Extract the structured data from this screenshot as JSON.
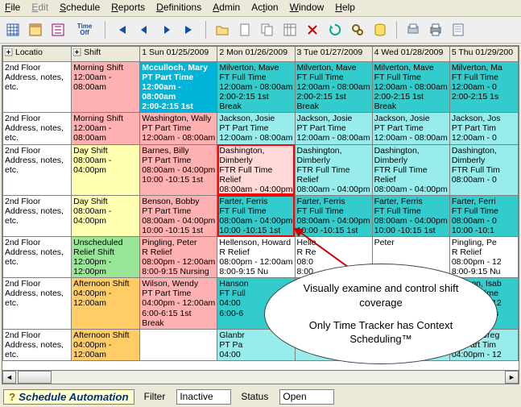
{
  "menu": {
    "file": "File",
    "edit": "Edit",
    "schedule": "Schedule",
    "reports": "Reports",
    "definitions": "Definitions",
    "admin": "Admin",
    "action": "Action",
    "window": "Window",
    "help": "Help"
  },
  "toolbar": {
    "timeoff_label": "Time Off"
  },
  "header": {
    "locatio": "Locatio",
    "shift": "Shift",
    "d1": "1 Sun 01/25/2009",
    "d2": "2 Mon 01/26/2009",
    "d3": "3 Tue 01/27/2009",
    "d4": "4 Wed 01/28/2009",
    "d5": "5 Thu 01/29/200"
  },
  "rows": [
    {
      "loc": {
        "l1": "2nd Floor",
        "l2": "Address, notes,",
        "l3": "etc."
      },
      "shift": {
        "cls": "c-pink",
        "l1": "Morning Shift",
        "l2": "12:00am -",
        "l3": "08:00am"
      },
      "cells": [
        {
          "cls": "highlight",
          "l1": "Mcculloch, Mary",
          "l2": "PT Part Time",
          "l3": "12:00am - 08:00am",
          "l4": "2:00-2:15 1st"
        },
        {
          "cls": "c-cyan",
          "l1": "Milverton, Mave",
          "l2": "FT Full Time",
          "l3": "12:00am - 08:00am",
          "l4": "2:00-2:15 1st Break"
        },
        {
          "cls": "c-cyan",
          "l1": "Milverton, Mave",
          "l2": "FT Full Time",
          "l3": "12:00am - 08:00am",
          "l4": "2:00-2:15 1st Break"
        },
        {
          "cls": "c-cyan",
          "l1": "Milverton, Mave",
          "l2": "FT Full Time",
          "l3": "12:00am - 08:00am",
          "l4": "2:00-2:15 1st Break"
        },
        {
          "cls": "c-cyan",
          "l1": "Milverton, Ma",
          "l2": "FT Full Time",
          "l3": "12:00am - 0",
          "l4": "2:00-2:15 1s"
        }
      ]
    },
    {
      "loc": {
        "l1": "2nd Floor",
        "l2": "Address, notes,",
        "l3": "etc."
      },
      "shift": {
        "cls": "c-pink",
        "l1": "Morning Shift",
        "l2": "12:00am -",
        "l3": "08:00am"
      },
      "cells": [
        {
          "cls": "c-pink",
          "l1": "Washington, Wally",
          "l2": "PT Part Time",
          "l3": "12:00am - 08:00am"
        },
        {
          "cls": "c-ltcyan",
          "l1": "Jackson, Josie",
          "l2": "PT Part Time",
          "l3": "12:00am - 08:00am"
        },
        {
          "cls": "c-ltcyan",
          "l1": "Jackson, Josie",
          "l2": "PT Part Time",
          "l3": "12:00am - 08:00am"
        },
        {
          "cls": "c-ltcyan",
          "l1": "Jackson, Josie",
          "l2": "PT Part Time",
          "l3": "12:00am - 08:00am"
        },
        {
          "cls": "c-ltcyan",
          "l1": "Jackson, Jos",
          "l2": "PT Part Tim",
          "l3": "12:00am - 0"
        }
      ]
    },
    {
      "loc": {
        "l1": "2nd Floor",
        "l2": "Address, notes,",
        "l3": "etc."
      },
      "shift": {
        "cls": "c-yellow",
        "l1": "Day Shift",
        "l2": "08:00am -",
        "l3": "04:00pm"
      },
      "cells": [
        {
          "cls": "c-pink",
          "l1": "Barnes, Billy",
          "l2": "PT Part Time",
          "l3": "08:00am - 04:00pm",
          "l4": "10:00 -10:15 1st"
        },
        {
          "cls": "c-ltpink red-outline",
          "l1": "Dashington, Dimberly",
          "l2": "FTR Full Time Relief",
          "l3": "08:00am - 04:00pm"
        },
        {
          "cls": "c-ltcyan",
          "l1": "Dashington, Dimberly",
          "l2": "FTR Full Time Relief",
          "l3": "08:00am - 04:00pm"
        },
        {
          "cls": "c-ltcyan",
          "l1": "Dashington, Dimberly",
          "l2": "FTR Full Time Relief",
          "l3": "08:00am - 04:00pm"
        },
        {
          "cls": "c-ltcyan",
          "l1": "Dashington,",
          "l2": "Dimberly",
          "l3": "FTR Full Tim",
          "l4": "08:00am - 0"
        }
      ]
    },
    {
      "loc": {
        "l1": "2nd Floor",
        "l2": "Address, notes,",
        "l3": "etc."
      },
      "shift": {
        "cls": "c-yellow",
        "l1": "Day Shift",
        "l2": "08:00am -",
        "l3": "04:00pm"
      },
      "cells": [
        {
          "cls": "c-pink",
          "l1": "Benson, Bobby",
          "l2": "PT Part Time",
          "l3": "08:00am - 04:00pm",
          "l4": "10:00 -10:15 1st"
        },
        {
          "cls": "c-cyan red-outline",
          "l1": "Farter, Ferris",
          "l2": "FT Full Time",
          "l3": "08:00am - 04:00pm",
          "l4": "10:00 -10:15 1st"
        },
        {
          "cls": "c-cyan",
          "l1": "Farter, Ferris",
          "l2": "FT Full Time",
          "l3": "08:00am - 04:00pm",
          "l4": "10:00 -10:15 1st"
        },
        {
          "cls": "c-cyan",
          "l1": "Farter, Ferris",
          "l2": "FT Full Time",
          "l3": "08:00am - 04:00pm",
          "l4": "10:00 -10:15 1st"
        },
        {
          "cls": "c-cyan",
          "l1": "Farter, Ferri",
          "l2": "FT Full Time",
          "l3": "08:00am - 0",
          "l4": "10:00 -10:1"
        }
      ]
    },
    {
      "loc": {
        "l1": "2nd Floor",
        "l2": "Address, notes,",
        "l3": "etc."
      },
      "shift": {
        "cls": "c-green",
        "l1": "Unscheduled Relief Shift",
        "l2": "12:00pm -",
        "l3": "12:00pm"
      },
      "cells": [
        {
          "cls": "c-pink",
          "l1": "Pingling, Peter",
          "l2": "R Relief",
          "l3": "08:00pm - 12:00am",
          "l4": "8:00-9:15 Nursing"
        },
        {
          "cls": "c-white",
          "l1": "Hellenson, Howard",
          "l2": "R Relief",
          "l3": "08:00pm - 12:00am",
          "l4": "8:00-9:15 Nu"
        },
        {
          "cls": "c-white",
          "l1": "Helle",
          "l2": "R Re",
          "l3": "08:0",
          "l4": "8:00"
        },
        {
          "cls": "c-white",
          "l1": "Peter",
          "l2": "",
          "l3": "",
          "l4": ""
        },
        {
          "cls": "c-white",
          "l1": "Pingling, Pe",
          "l2": "R Relief",
          "l3": "08:00pm - 12",
          "l4": "8:00-9:15 Nu"
        }
      ]
    },
    {
      "loc": {
        "l1": "2nd Floor",
        "l2": "Address, notes,",
        "l3": "etc."
      },
      "shift": {
        "cls": "c-orange",
        "l1": "Afternoon Shift",
        "l2": "04:00pm -",
        "l3": "12:00am"
      },
      "cells": [
        {
          "cls": "c-pink",
          "l1": "Wilson, Wendy",
          "l2": "PT Part Time",
          "l3": "04:00pm - 12:00am",
          "l4": "6:00-6:15 1st Break"
        },
        {
          "cls": "c-cyan",
          "l1": "Hanson",
          "l2": "FT Full",
          "l3": "04:00",
          "l4": "6:00-6"
        },
        {
          "cls": "c-cyan",
          "l1": "",
          "l2": "",
          "l3": "",
          "l4": ""
        },
        {
          "cls": "c-cyan",
          "l1": "",
          "l2": "",
          "l3": "",
          "l4": ""
        },
        {
          "cls": "c-cyan",
          "l1": "Hanson, Isab",
          "l2": "FT Full Time",
          "l3": "04:00pm - 12",
          "l4": "6:00-6:15 1s"
        }
      ]
    },
    {
      "loc": {
        "l1": "2nd Floor",
        "l2": "Address, notes,",
        "l3": "etc."
      },
      "shift": {
        "cls": "c-orange",
        "l1": "Afternoon Shift",
        "l2": "04:00pm -",
        "l3": "12:00am"
      },
      "cells": [
        {
          "cls": "c-white",
          "l1": "",
          "l2": "",
          "l3": ""
        },
        {
          "cls": "c-ltcyan",
          "l1": "Glanbr",
          "l2": "PT Pa",
          "l3": "04:00"
        },
        {
          "cls": "c-ltcyan",
          "l1": "",
          "l2": "",
          "l3": ""
        },
        {
          "cls": "c-ltcyan",
          "l1": "",
          "l2": "",
          "l3": ""
        },
        {
          "cls": "c-ltcyan",
          "l1": "Arnold, Greg",
          "l2": "PT Part Tim",
          "l3": "04:00pm - 12"
        }
      ]
    }
  ],
  "callout": {
    "line1": "Visually examine and control shift coverage",
    "line2": "Only Time Tracker has Context Scheduling™"
  },
  "footer": {
    "automation": "Schedule Automation",
    "filter_label": "Filter",
    "filter_value": "Inactive",
    "status_label": "Status",
    "status_value": "Open"
  }
}
